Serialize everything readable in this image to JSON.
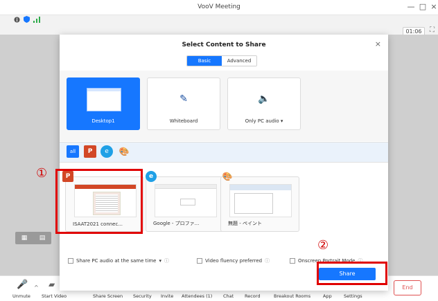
{
  "window": {
    "title": "VooV Meeting",
    "minimize": "—",
    "maximize": "□",
    "close": "×"
  },
  "status": {
    "timer": "01:06",
    "fullscreen_glyph": "⛶"
  },
  "dialog": {
    "title": "Select Content to Share",
    "close_glyph": "×",
    "tabs": [
      {
        "label": "Basic",
        "active": true
      },
      {
        "label": "Advanced",
        "active": false
      }
    ],
    "basic_items": [
      {
        "label": "Desktop1",
        "selected": true
      },
      {
        "label": "Whiteboard",
        "selected": false
      },
      {
        "label": "Only PC audio ▾",
        "selected": false
      }
    ],
    "filters": {
      "all": "all",
      "ppt": "P",
      "edge": "e",
      "paint": "🎨"
    },
    "windows": [
      {
        "label": "ISAAT2021 connec...",
        "app": "powerpoint"
      },
      {
        "label": "Google - プロファ...",
        "app": "edge"
      },
      {
        "label": "無題 - ペイント",
        "app": "paint"
      }
    ],
    "options": [
      {
        "label": "Share PC audio at the same time",
        "suffix": "▾"
      },
      {
        "label": "Video fluency preferred",
        "suffix": ""
      },
      {
        "label": "Onscreen Portrait Mode",
        "suffix": ""
      }
    ],
    "help_glyph": "ⓘ",
    "share_label": "Share"
  },
  "annotations": {
    "marker_1": "①",
    "marker_2": "②"
  },
  "toolbar": {
    "items": [
      "Unmute",
      "Start Video",
      "Share Screen",
      "Security",
      "Invite",
      "Attendees (1)",
      "Chat",
      "Record",
      "Breakout Rooms",
      "App",
      "Settings"
    ],
    "end_label": "End"
  },
  "colors": {
    "accent": "#1677ff",
    "annotation": "#e00000"
  }
}
